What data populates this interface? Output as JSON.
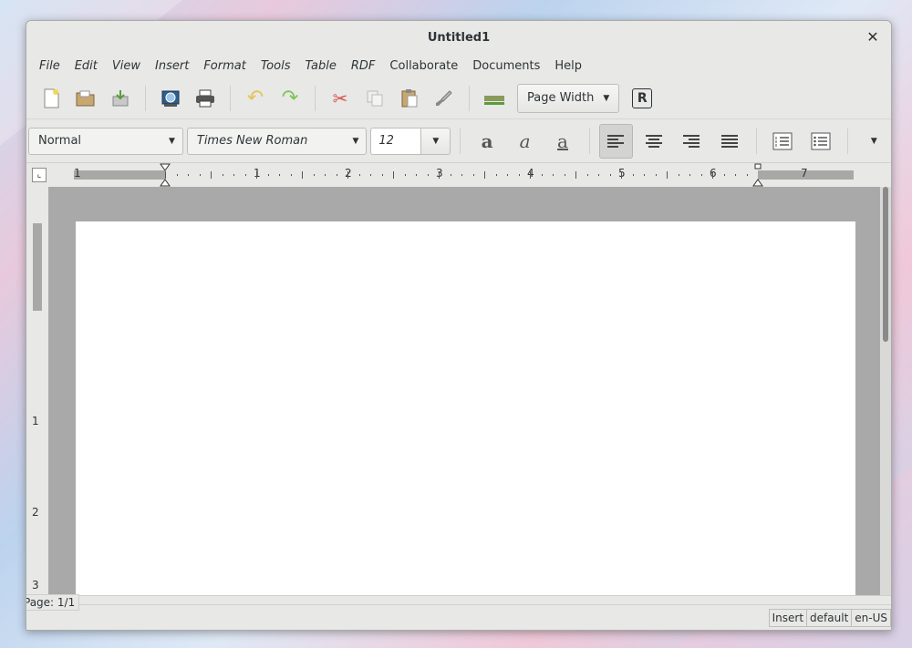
{
  "window": {
    "title": "Untitled1"
  },
  "menu": [
    "File",
    "Edit",
    "View",
    "Insert",
    "Format",
    "Tools",
    "Table",
    "RDF",
    "Collaborate",
    "Documents",
    "Help"
  ],
  "toolbar": {
    "zoom": "Page Width"
  },
  "format_bar": {
    "style": "Normal",
    "font": "Times New Roman",
    "size": "12"
  },
  "ruler": {
    "h_labels": [
      "1",
      "1",
      "2",
      "3",
      "4",
      "5",
      "6",
      "7"
    ],
    "v_labels": [
      "1",
      "2",
      "3"
    ]
  },
  "status": {
    "page": "Page: 1/1",
    "mode": "Insert",
    "style": "default",
    "language": "en-US"
  }
}
